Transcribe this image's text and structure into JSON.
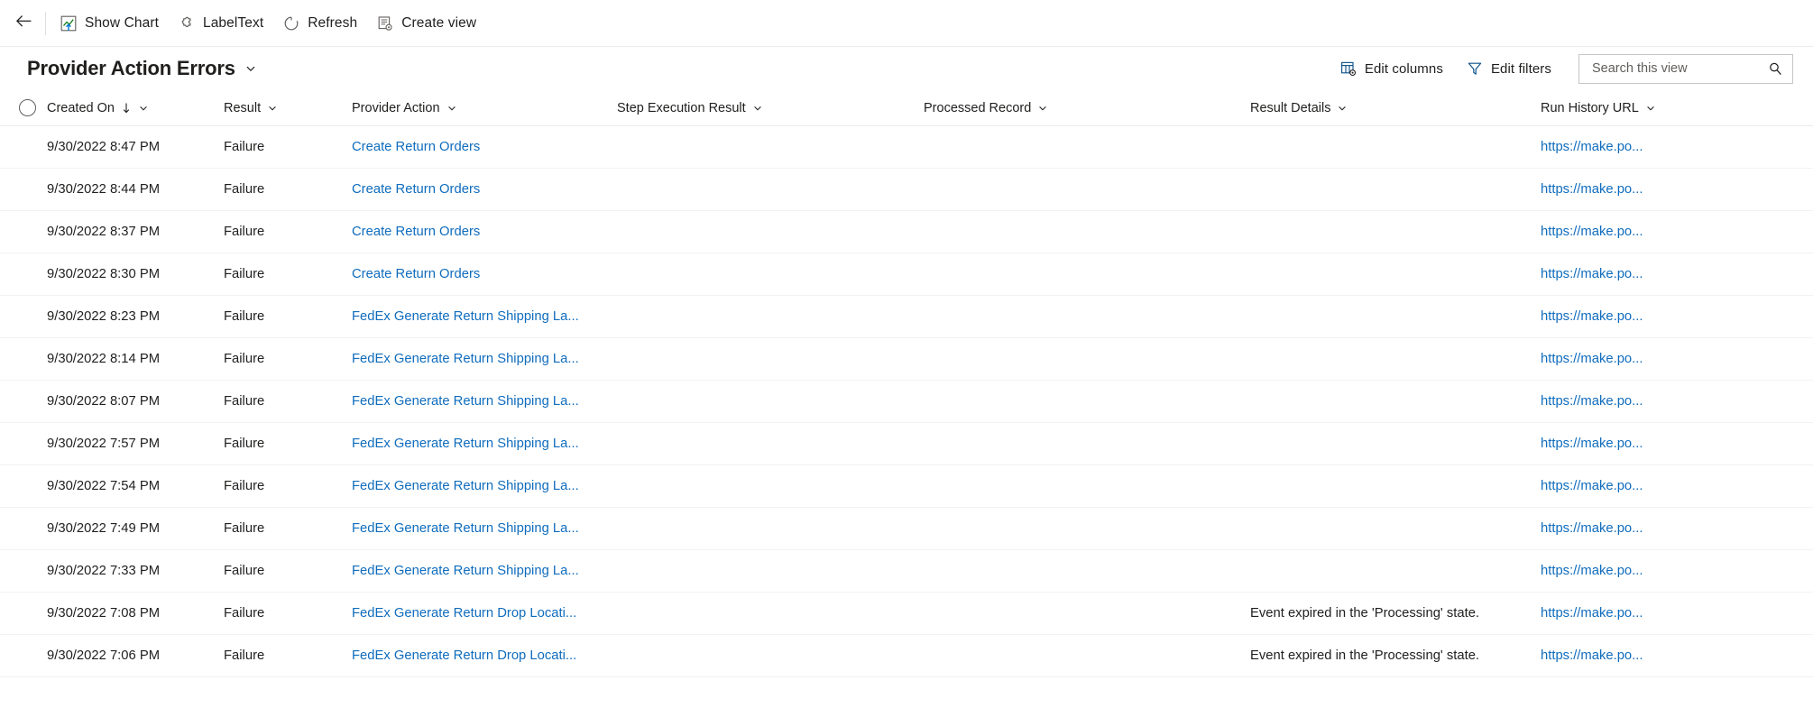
{
  "command_bar": {
    "back": {
      "icon": "back-arrow-icon",
      "label": "Back"
    },
    "items": [
      {
        "icon": "show-chart-icon",
        "label": "Show Chart"
      },
      {
        "icon": "puzzle-piece-icon",
        "label": "LabelText"
      },
      {
        "icon": "refresh-icon",
        "label": "Refresh"
      },
      {
        "icon": "create-view-icon",
        "label": "Create view"
      }
    ]
  },
  "title_bar": {
    "title": "Provider Action Errors",
    "chevron_icon": "chevron-down-icon",
    "edit_columns": {
      "icon": "edit-columns-icon",
      "label": "Edit columns"
    },
    "edit_filters": {
      "icon": "filter-icon",
      "label": "Edit filters"
    },
    "search": {
      "placeholder": "Search this view",
      "value": "",
      "icon": "search-icon"
    }
  },
  "grid": {
    "select_all_icon": "select-all-circle-icon",
    "columns": [
      {
        "key": "created_on",
        "label": "Created On",
        "sorted": true,
        "sort_dir": "asc"
      },
      {
        "key": "result",
        "label": "Result",
        "sorted": false
      },
      {
        "key": "action",
        "label": "Provider Action",
        "sorted": false
      },
      {
        "key": "step",
        "label": "Step Execution Result",
        "sorted": false
      },
      {
        "key": "record",
        "label": "Processed Record",
        "sorted": false
      },
      {
        "key": "details",
        "label": "Result Details",
        "sorted": false
      },
      {
        "key": "url",
        "label": "Run History URL",
        "sorted": false
      }
    ],
    "rows": [
      {
        "created_on": "9/30/2022 8:47 PM",
        "result": "Failure",
        "action": "Create Return Orders",
        "step": "",
        "record": "",
        "details": "",
        "url": "https://make.po..."
      },
      {
        "created_on": "9/30/2022 8:44 PM",
        "result": "Failure",
        "action": "Create Return Orders",
        "step": "",
        "record": "",
        "details": "",
        "url": "https://make.po..."
      },
      {
        "created_on": "9/30/2022 8:37 PM",
        "result": "Failure",
        "action": "Create Return Orders",
        "step": "",
        "record": "",
        "details": "",
        "url": "https://make.po..."
      },
      {
        "created_on": "9/30/2022 8:30 PM",
        "result": "Failure",
        "action": "Create Return Orders",
        "step": "",
        "record": "",
        "details": "",
        "url": "https://make.po..."
      },
      {
        "created_on": "9/30/2022 8:23 PM",
        "result": "Failure",
        "action": "FedEx Generate Return Shipping La...",
        "step": "",
        "record": "",
        "details": "",
        "url": "https://make.po..."
      },
      {
        "created_on": "9/30/2022 8:14 PM",
        "result": "Failure",
        "action": "FedEx Generate Return Shipping La...",
        "step": "",
        "record": "",
        "details": "",
        "url": "https://make.po..."
      },
      {
        "created_on": "9/30/2022 8:07 PM",
        "result": "Failure",
        "action": "FedEx Generate Return Shipping La...",
        "step": "",
        "record": "",
        "details": "",
        "url": "https://make.po..."
      },
      {
        "created_on": "9/30/2022 7:57 PM",
        "result": "Failure",
        "action": "FedEx Generate Return Shipping La...",
        "step": "",
        "record": "",
        "details": "",
        "url": "https://make.po..."
      },
      {
        "created_on": "9/30/2022 7:54 PM",
        "result": "Failure",
        "action": "FedEx Generate Return Shipping La...",
        "step": "",
        "record": "",
        "details": "",
        "url": "https://make.po..."
      },
      {
        "created_on": "9/30/2022 7:49 PM",
        "result": "Failure",
        "action": "FedEx Generate Return Shipping La...",
        "step": "",
        "record": "",
        "details": "",
        "url": "https://make.po..."
      },
      {
        "created_on": "9/30/2022 7:33 PM",
        "result": "Failure",
        "action": "FedEx Generate Return Shipping La...",
        "step": "",
        "record": "",
        "details": "",
        "url": "https://make.po..."
      },
      {
        "created_on": "9/30/2022 7:08 PM",
        "result": "Failure",
        "action": "FedEx Generate Return Drop Locati...",
        "step": "",
        "record": "",
        "details": "Event expired in the 'Processing' state.",
        "url": "https://make.po..."
      },
      {
        "created_on": "9/30/2022 7:06 PM",
        "result": "Failure",
        "action": "FedEx Generate Return Drop Locati...",
        "step": "",
        "record": "",
        "details": "Event expired in the 'Processing' state.",
        "url": "https://make.po..."
      }
    ]
  },
  "colors": {
    "link": "#0f6cbd",
    "text": "#201f1e",
    "divider": "#f3f2f1",
    "accent_green": "#107c10",
    "accent_blue": "#0078d4"
  }
}
